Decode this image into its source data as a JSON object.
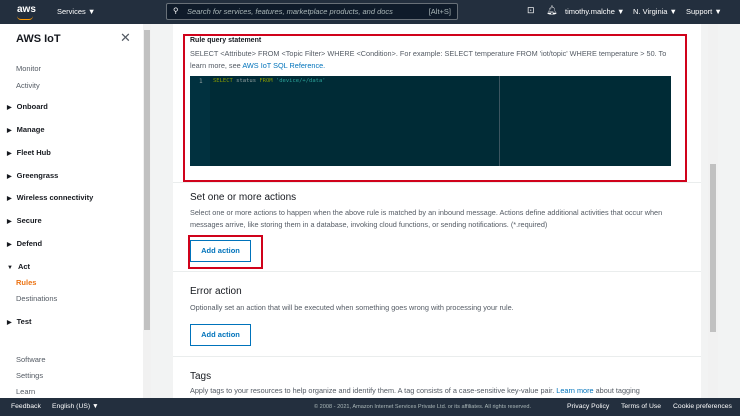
{
  "topbar": {
    "logo": "aws",
    "services": "Services ▼",
    "search_placeholder": "Search for services, features, marketplace products, and docs",
    "shortcut": "[Alt+S]",
    "user": "timothy.malche ▼",
    "region": "N. Virginia ▼",
    "support": "Support ▼"
  },
  "sidebar": {
    "title": "AWS IoT",
    "items": [
      "Monitor",
      "Activity"
    ],
    "groups": [
      "Onboard",
      "Manage",
      "Fleet Hub",
      "Greengrass",
      "Wireless connectivity",
      "Secure",
      "Defend",
      "Act"
    ],
    "act_items": [
      "Rules",
      "Destinations"
    ],
    "test": "Test",
    "bottom": [
      "Software",
      "Settings",
      "Learn"
    ],
    "active_color": "#ec7211"
  },
  "rule_query": {
    "label": "Rule query statement",
    "desc": "SELECT <Attribute> FROM <Topic Filter> WHERE <Condition>. For example: SELECT temperature FROM 'iot/topic' WHERE temperature > 50. To learn more, see ",
    "link": "AWS IoT SQL Reference.",
    "line_no": "1",
    "code_kw1": "SELECT",
    "code_mid": " status ",
    "code_kw2": "FROM",
    "code_str": " 'device/+/data'"
  },
  "actions": {
    "title": "Set one or more actions",
    "desc": "Select one or more actions to happen when the above rule is matched by an inbound message. Actions define additional activities that occur when messages arrive, like storing them in a database, invoking cloud functions, or sending notifications. (*.required)",
    "button": "Add action"
  },
  "error_action": {
    "title": "Error action",
    "desc": "Optionally set an action that will be executed when something goes wrong with processing your rule.",
    "button": "Add action"
  },
  "tags": {
    "title": "Tags",
    "desc": "Apply tags to your resources to help organize and identify them. A tag consists of a case-sensitive key-value pair. ",
    "link": "Learn more",
    "desc2": " about tagging"
  },
  "footer": {
    "feedback": "Feedback",
    "language": "English (US) ▼",
    "copyright": "© 2008 - 2021, Amazon Internet Services Private Ltd. or its affiliates. All rights reserved.",
    "privacy": "Privacy Policy",
    "terms": "Terms of Use",
    "cookies": "Cookie preferences"
  }
}
